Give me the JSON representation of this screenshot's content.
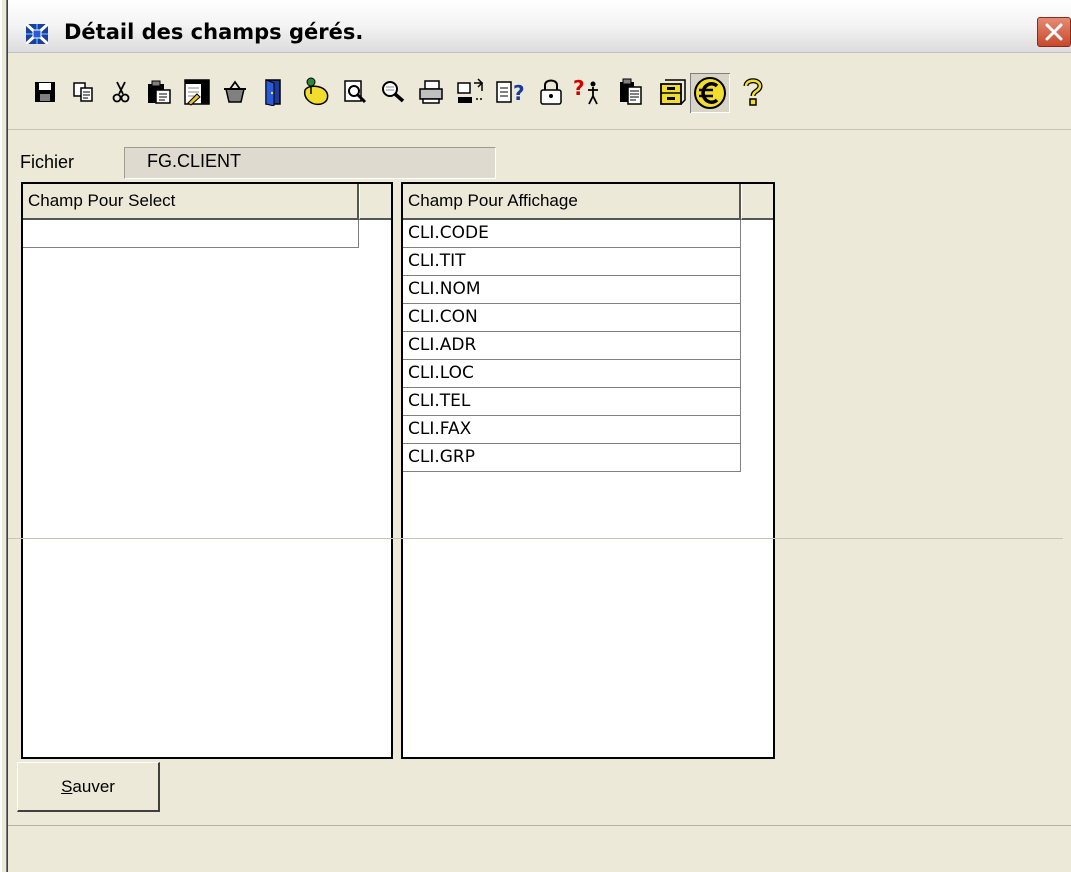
{
  "window": {
    "title": "Détail des champs gérés."
  },
  "toolbar": {
    "buttons": [
      {
        "name": "save-icon"
      },
      {
        "name": "copy-icon"
      },
      {
        "name": "cut-icon"
      },
      {
        "name": "paste-icon"
      },
      {
        "name": "edit-form-icon"
      },
      {
        "name": "basket-icon"
      },
      {
        "name": "exit-door-icon"
      },
      {
        "name": "pins-icon"
      },
      {
        "name": "search-document-icon"
      },
      {
        "name": "find-icon"
      },
      {
        "name": "print-icon"
      },
      {
        "name": "transfer-icon"
      },
      {
        "name": "document-help-icon"
      },
      {
        "name": "lock-icon"
      },
      {
        "name": "what-is-this-icon"
      },
      {
        "name": "clipboard-list-icon"
      },
      {
        "name": "archive-cabinet-icon"
      },
      {
        "name": "euro-icon",
        "pressed": true
      },
      {
        "name": "help-icon"
      }
    ]
  },
  "fichier": {
    "label": "Fichier",
    "value": "FG.CLIENT"
  },
  "select_grid": {
    "header": "Champ Pour Select",
    "rows": [
      ""
    ]
  },
  "display_grid": {
    "header": "Champ Pour Affichage",
    "rows": [
      "CLI.CODE",
      "CLI.TIT",
      "CLI.NOM",
      "CLI.CON",
      "CLI.ADR",
      "CLI.LOC",
      "CLI.TEL",
      "CLI.FAX",
      "CLI.GRP"
    ]
  },
  "actions": {
    "save_mnemonic": "S",
    "save_rest": "auver"
  },
  "colors": {
    "background": "#ECE9D8",
    "close_button": "#D0573C",
    "accent_yellow": "#F2DD2C"
  }
}
